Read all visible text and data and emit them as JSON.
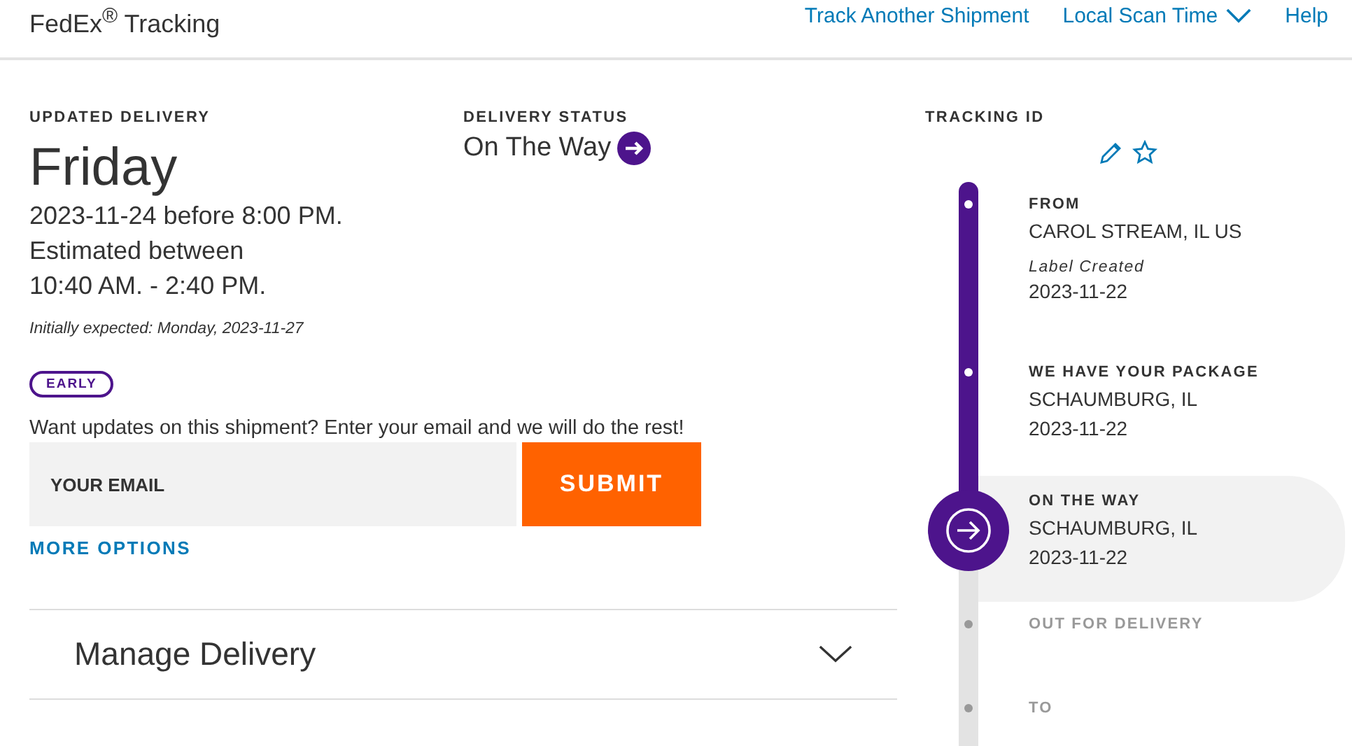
{
  "header": {
    "logo": "FedEx$^{®}$ Tracking",
    "links": [
      {
        "label": "Track Another Shipment",
        "dropdown": false
      },
      {
        "label": "Local Scan Time",
        "dropdown": true
      },
      {
        "label": "Help",
        "dropdown": false
      }
    ]
  },
  "delivery": {
    "heading": "UPDATED DELIVERY",
    "day": "Friday",
    "lines": [
      "2023-11-24 before 8:00 PM.",
      "Estimated between",
      "10:40 AM. - 2:40 PM."
    ],
    "initially": "Initially expected: Monday, 2023-11-27",
    "badge": "EARLY"
  },
  "status": {
    "heading": "DELIVERY STATUS",
    "value": "On The Way"
  },
  "updates": {
    "prompt": "Want updates on this shipment? Enter your email and we will do the rest!",
    "placeholder": "YOUR EMAIL",
    "submit": "SUBMIT",
    "more": "MORE OPTIONS"
  },
  "manage": {
    "label": "Manage Delivery",
    "expanded": false
  },
  "tracking": {
    "heading": "TRACKING ID",
    "steps": [
      {
        "kind": "done",
        "title": "FROM",
        "location": "CAROL STREAM, IL US",
        "note": "Label Created",
        "date": "2023-11-22"
      },
      {
        "kind": "done",
        "title": "WE HAVE YOUR PACKAGE",
        "location": "SCHAUMBURG, IL",
        "date": "2023-11-22"
      },
      {
        "kind": "current",
        "title": "ON THE WAY",
        "location": "SCHAUMBURG, IL",
        "date": "2023-11-22"
      },
      {
        "kind": "pending",
        "title": "OUT FOR DELIVERY"
      },
      {
        "kind": "pending",
        "title": "TO"
      }
    ]
  }
}
